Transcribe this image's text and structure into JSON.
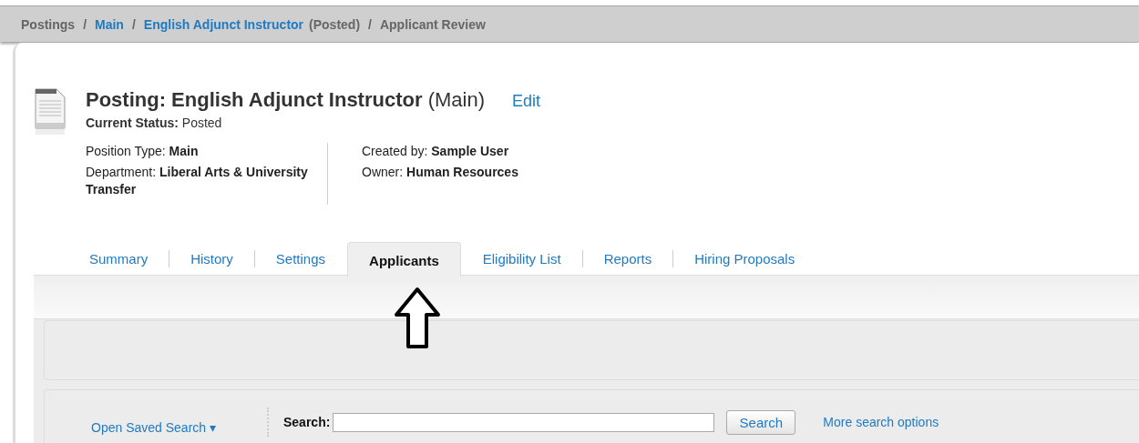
{
  "breadcrumb": [
    {
      "kind": "text",
      "label": "Postings"
    },
    {
      "kind": "link",
      "label": "Main",
      "separator": "/"
    },
    {
      "kind": "link",
      "label": "English Adjunct Instructor",
      "suffix": "(Posted)",
      "separator": "/"
    },
    {
      "kind": "text",
      "label": "Applicant Review",
      "separator": "/"
    }
  ],
  "header": {
    "title": "Posting: English Adjunct Instructor",
    "title_suffix": "(Main)",
    "edit_link": "Edit",
    "status_label": "Current Status:",
    "status_value": "Posted"
  },
  "details": [
    [
      {
        "label": "Position Type:",
        "value": "Main"
      },
      {
        "label": "Department:",
        "value_lines": [
          "Liberal Arts & University",
          "Transfer"
        ]
      }
    ],
    [
      {
        "label": "Created by:",
        "value": "Sample User"
      },
      {
        "label": "Owner:",
        "value": "Human Resources"
      }
    ]
  ],
  "tabs": [
    {
      "label": "Summary",
      "selected": false
    },
    {
      "label": "History",
      "selected": false
    },
    {
      "label": "Settings",
      "selected": false
    },
    {
      "label": "Applicants",
      "selected": true
    },
    {
      "label": "Eligibility List",
      "selected": false
    },
    {
      "label": "Reports",
      "selected": false
    },
    {
      "label": "Hiring Proposals",
      "selected": false
    }
  ],
  "search": {
    "saved_search": "Open Saved Search",
    "saved_search_caret": "▾",
    "label": "Search:",
    "button": "Search",
    "more_link": "More search options"
  }
}
